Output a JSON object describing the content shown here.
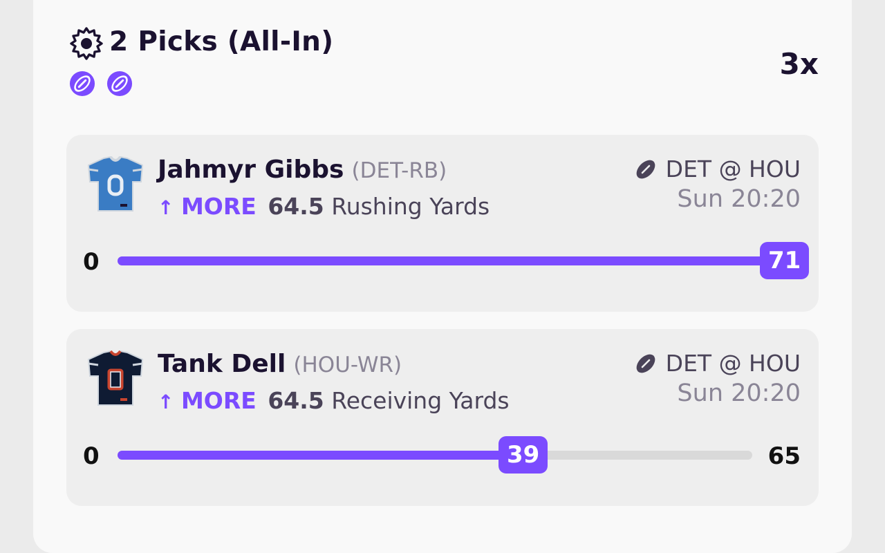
{
  "header": {
    "icon": "gear-icon",
    "title": "2 Picks (All-In)",
    "sport_icons": [
      "football-icon",
      "football-icon"
    ],
    "multiplier": "3x"
  },
  "colors": {
    "accent": "#7b4bff",
    "card_bg": "#f9f9f9",
    "pick_bg": "#eeeeee",
    "track": "#d9d9d9",
    "text_dark": "#1b1230"
  },
  "picks": [
    {
      "player": "Jahmyr Gibbs",
      "position": "(DET-RB)",
      "jersey": "det-jersey-icon",
      "direction_arrow": "↑",
      "direction": "MORE",
      "line": "64.5",
      "stat": "Rushing Yards",
      "matchup": "DET @ HOU",
      "time": "Sun 20:20",
      "progress": {
        "start": "0",
        "current": "71",
        "end": "",
        "fraction": 1.0
      }
    },
    {
      "player": "Tank Dell",
      "position": "(HOU-WR)",
      "jersey": "hou-jersey-icon",
      "direction_arrow": "↑",
      "direction": "MORE",
      "line": "64.5",
      "stat": "Receiving Yards",
      "matchup": "DET @ HOU",
      "time": "Sun 20:20",
      "progress": {
        "start": "0",
        "current": "39",
        "end": "65",
        "fraction": 0.6
      }
    }
  ]
}
